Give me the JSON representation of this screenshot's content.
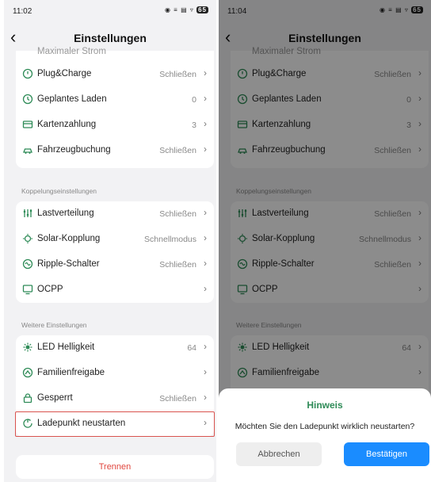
{
  "colors": {
    "accent": "#2e8b57",
    "highlight": "#d9534f",
    "danger": "#e0463e",
    "primary_button": "#1a8cff"
  },
  "left": {
    "status": {
      "time": "11:02",
      "icons": "◉ ≡ ▤ ▿",
      "battery": "65"
    },
    "title": "Einstellungen",
    "cut_label": "Maximaler Strom",
    "group1": [
      {
        "label": "Plug&Charge",
        "value": "Schließen",
        "icon": "power-circle-icon"
      },
      {
        "label": "Geplantes Laden",
        "value": "0",
        "icon": "clock-icon"
      },
      {
        "label": "Kartenzahlung",
        "value": "3",
        "icon": "card-icon"
      },
      {
        "label": "Fahrzeugbuchung",
        "value": "Schließen",
        "icon": "car-booking-icon"
      }
    ],
    "section2": "Koppelungseinstellungen",
    "group2": [
      {
        "label": "Lastverteilung",
        "value": "Schließen",
        "icon": "sliders-icon"
      },
      {
        "label": "Solar-Kopplung",
        "value": "Schnellmodus",
        "icon": "sun-icon"
      },
      {
        "label": "Ripple-Schalter",
        "value": "Schließen",
        "icon": "ripple-icon"
      },
      {
        "label": "OCPP",
        "value": "",
        "icon": "monitor-icon"
      }
    ],
    "section3": "Weitere Einstellungen",
    "group3": [
      {
        "label": "LED Helligkeit",
        "value": "64",
        "icon": "brightness-icon"
      },
      {
        "label": "Familienfreigabe",
        "value": "",
        "icon": "share-icon"
      },
      {
        "label": "Gesperrt",
        "value": "Schließen",
        "icon": "lock-icon"
      },
      {
        "label": "Ladepunkt neustarten",
        "value": "",
        "icon": "restart-icon"
      }
    ],
    "disconnect": "Trennen"
  },
  "right": {
    "status": {
      "time": "11:04",
      "icons": "◉ ≡ ▤ ▿",
      "battery": "65"
    },
    "title": "Einstellungen",
    "dialog": {
      "title": "Hinweis",
      "message": "Möchten Sie den Ladepunkt wirklich neustarten?",
      "cancel": "Abbrechen",
      "confirm": "Bestätigen"
    }
  }
}
